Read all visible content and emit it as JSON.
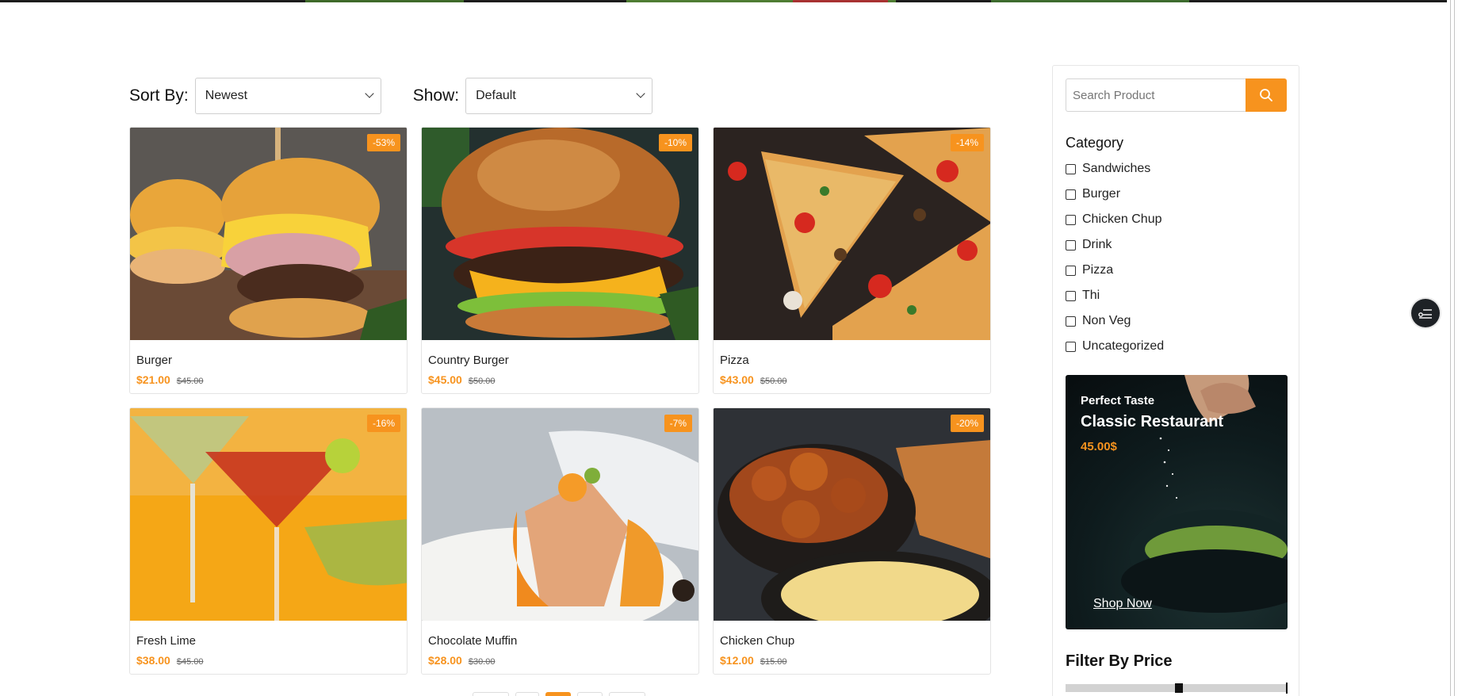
{
  "toolbar": {
    "sort_label": "Sort By:",
    "sort_value": "Newest",
    "show_label": "Show:",
    "show_value": "Default"
  },
  "products": [
    {
      "name": "Burger",
      "price": "$21.00",
      "old_price": "$45.00",
      "badge": "-53%"
    },
    {
      "name": "Country Burger",
      "price": "$45.00",
      "old_price": "$50.00",
      "badge": "-10%"
    },
    {
      "name": "Pizza",
      "price": "$43.00",
      "old_price": "$50.00",
      "badge": "-14%"
    },
    {
      "name": "Fresh Lime",
      "price": "$38.00",
      "old_price": "$45.00",
      "badge": "-16%"
    },
    {
      "name": "Chocolate Muffin",
      "price": "$28.00",
      "old_price": "$30.00",
      "badge": "-7%"
    },
    {
      "name": "Chicken Chup",
      "price": "$12.00",
      "old_price": "$15.00",
      "badge": "-20%"
    }
  ],
  "sidebar": {
    "search_placeholder": "Search Product",
    "category_title": "Category",
    "categories": [
      "Sandwiches",
      "Burger",
      "Chicken Chup",
      "Drink",
      "Pizza",
      "Thi",
      "Non Veg",
      "Uncategorized"
    ],
    "promo": {
      "subtitle": "Perfect Taste",
      "title": "Classic Restaurant",
      "price": "45.00$",
      "cta": "Shop Now"
    },
    "price_filter_title": "Filter By Price",
    "price_filter_position": 0.5
  },
  "pagination": {
    "active_page_index": 2
  },
  "colors": {
    "accent": "#f7931e",
    "text": "#111111",
    "border": "#e4e4e4"
  }
}
